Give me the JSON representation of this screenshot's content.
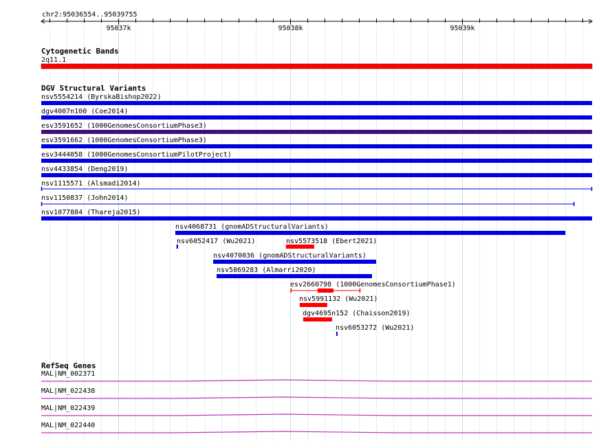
{
  "browser": {
    "location": "chr2:95036554..95039755",
    "ruler": {
      "range_start": 95036554,
      "range_end": 95039755,
      "major_tick_labels": [
        "95037k",
        "95038k",
        "95039k"
      ]
    },
    "colors": {
      "grid_major": "#c8e0e8",
      "grid_minor": "#e4eff4",
      "feature_blue": "#0000e0",
      "feature_red": "#ff0000",
      "feature_purple": "#3f0f7f",
      "gene_magenta": "#c030c0"
    },
    "tracks": {
      "cytoband": {
        "title": "Cytogenetic Bands",
        "features": [
          {
            "label": "2q11.1",
            "start": 95036554,
            "end": 95039755,
            "color": "#ff0000",
            "style": "solid"
          }
        ]
      },
      "dgv": {
        "title": "DGV Structural Variants",
        "features": [
          {
            "label": "nsv5554214 (ByrskaBishop2022)",
            "start": 95036554,
            "end": 95039755,
            "color": "#0000e0",
            "style": "solid"
          },
          {
            "label": "dgv4007n100 (Coe2014)",
            "start": 95036554,
            "end": 95039755,
            "color": "#0000e0",
            "style": "solid"
          },
          {
            "label": "esv3591652 (1000GenomesConsortiumPhase3)",
            "start": 95036554,
            "end": 95039755,
            "color": "#3f0f7f",
            "style": "solid"
          },
          {
            "label": "esv3591662 (1000GenomesConsortiumPhase3)",
            "start": 95036554,
            "end": 95039755,
            "color": "#0000e0",
            "style": "solid"
          },
          {
            "label": "esv3444058 (1000GenomesConsortiumPilotProject)",
            "start": 95036554,
            "end": 95039755,
            "color": "#0000e0",
            "style": "solid"
          },
          {
            "label": "nsv4433854 (Deng2019)",
            "start": 95036554,
            "end": 95039755,
            "color": "#0000e0",
            "style": "solid"
          },
          {
            "label": "nsv1115571 (Alsmadi2014)",
            "start": 95036554,
            "end": 95039755,
            "color": "#0000e0",
            "style": "line"
          },
          {
            "label": "nsv1150837 (John2014)",
            "start": 95036554,
            "end": 95039652,
            "color": "#0000e0",
            "style": "line"
          },
          {
            "label": "nsv1077884 (Thareja2015)",
            "start": 95036554,
            "end": 95039755,
            "color": "#0000e0",
            "style": "solid"
          },
          {
            "label": "nsv4068731 (gnomADStructuralVariants)",
            "start": 95037333,
            "end": 95039600,
            "color": "#0000e0",
            "style": "solid"
          },
          {
            "label": "nsv6052417 (Wu2021)",
            "start": 95037340,
            "end": 95037349,
            "color": "#0000e0",
            "style": "solid"
          },
          {
            "label": "nsv5573518 (Ebert2021)",
            "start": 95037976,
            "end": 95038140,
            "color": "#ff0000",
            "style": "solid"
          },
          {
            "label": "nsv4070036 (gnomADStructuralVariants)",
            "start": 95037553,
            "end": 95038500,
            "color": "#0000e0",
            "style": "solid"
          },
          {
            "label": "nsv5869283 (Almarri2020)",
            "start": 95037573,
            "end": 95038476,
            "color": "#0000e0",
            "style": "solid"
          },
          {
            "label": "esv2660798 (1000GenomesConsortiumPhase1)",
            "start": 95038004,
            "end": 95038408,
            "color": "#ff0000",
            "style": "core",
            "core_start": 95038160,
            "core_end": 95038252
          },
          {
            "label": "nsv5991132 (Wu2021)",
            "start": 95038056,
            "end": 95038216,
            "color": "#ff0000",
            "style": "solid"
          },
          {
            "label": "dgv4695n152 (Chaisson2019)",
            "start": 95038076,
            "end": 95038244,
            "color": "#ff0000",
            "style": "solid"
          },
          {
            "label": "nsv6053272 (Wu2021)",
            "start": 95038268,
            "end": 95038276,
            "color": "#0000e0",
            "style": "solid"
          }
        ]
      },
      "refseq": {
        "title": "RefSeq Genes",
        "features": [
          {
            "label": "MAL|NM_002371",
            "start": 95036554,
            "end": 95039755,
            "color": "#c030c0",
            "style": "gene"
          },
          {
            "label": "MAL|NM_022438",
            "start": 95036554,
            "end": 95039755,
            "color": "#c030c0",
            "style": "gene"
          },
          {
            "label": "MAL|NM_022439",
            "start": 95036554,
            "end": 95039755,
            "color": "#c030c0",
            "style": "gene"
          },
          {
            "label": "MAL|NM_022440",
            "start": 95036554,
            "end": 95039755,
            "color": "#c030c0",
            "style": "gene"
          }
        ]
      }
    }
  }
}
